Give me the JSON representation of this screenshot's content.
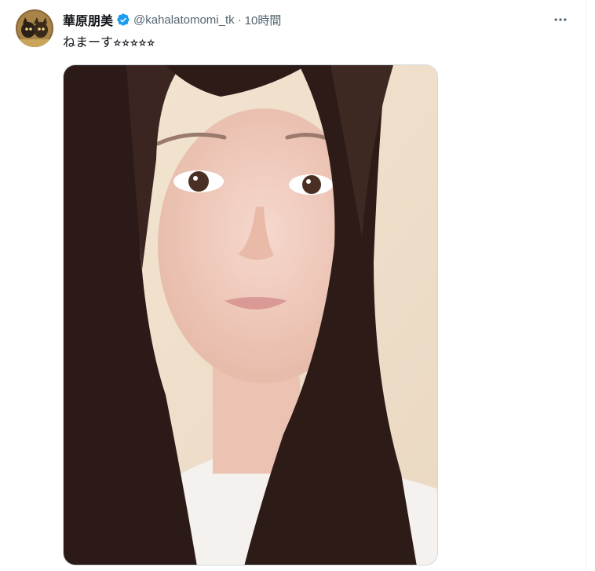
{
  "tweet": {
    "author_name": "華原朋美",
    "handle": "@kahalatomomi_tk",
    "separator": "·",
    "time": "10時間",
    "text": "ねまーす⭐︎⭐︎⭐︎⭐︎⭐︎",
    "verified": true
  },
  "icons": {
    "verified": "verified-badge-icon",
    "more": "more-options-icon"
  },
  "colors": {
    "verified_blue": "#1d9bf0",
    "secondary_text": "#536471",
    "primary_text": "#0f1419"
  }
}
